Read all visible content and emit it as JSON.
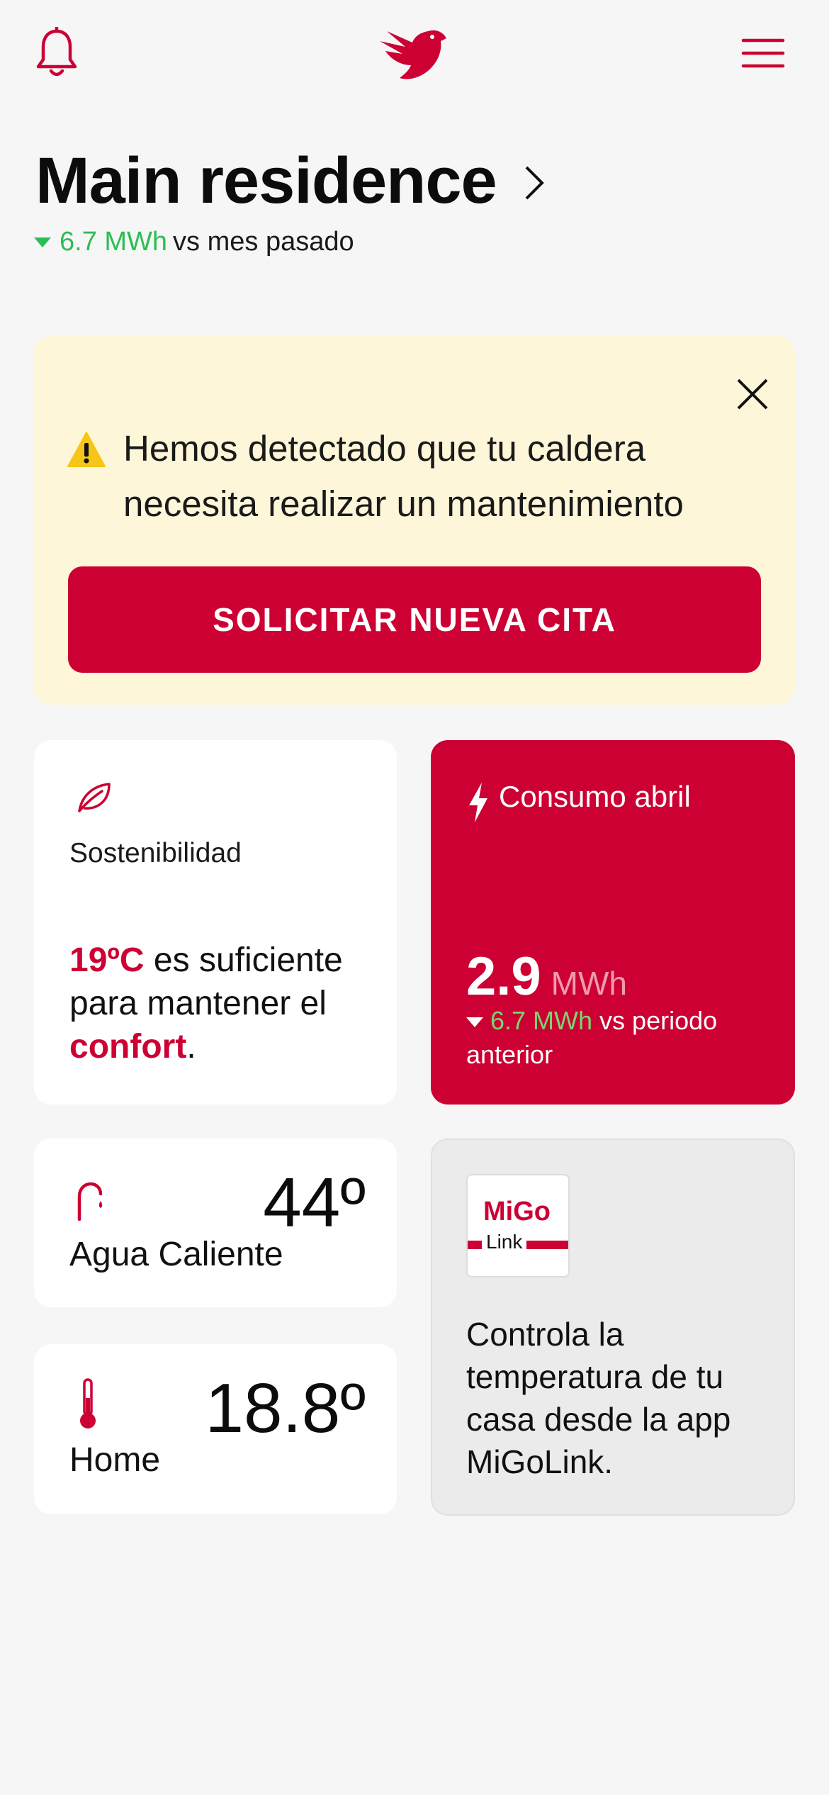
{
  "colors": {
    "brand": "#cc0033",
    "positive": "#2dbd55",
    "alert_bg": "#fef6d9",
    "background": "#f6f6f6"
  },
  "header": {
    "left_icon": "bell-icon",
    "center_icon": "bird-logo",
    "right_icon": "hamburger-menu-icon"
  },
  "residence": {
    "title": "Main residence",
    "delta_value": "6.7 MWh",
    "delta_label": "vs mes pasado",
    "delta_direction": "down"
  },
  "alert": {
    "message": "Hemos detectado que tu caldera necesita realizar un mantenimiento",
    "button_label": "SOLICITAR NUEVA CITA",
    "icon": "warning-icon",
    "close_icon": "close-icon"
  },
  "sustainability": {
    "label": "Sostenibilidad",
    "temp": "19ºC",
    "text_mid": " es suficiente para mantener el ",
    "highlight": "confort",
    "text_end": "."
  },
  "consumption": {
    "label": "Consumo abril",
    "value": "2.9",
    "unit": "MWh",
    "delta_value": "6.7 MWh",
    "delta_label": " vs periodo anterior",
    "delta_direction": "down"
  },
  "hot_water": {
    "label": "Agua Caliente",
    "temperature": "44º",
    "icon": "faucet-icon"
  },
  "home_temp": {
    "label": "Home",
    "temperature": "18.8º",
    "icon": "thermometer-icon"
  },
  "promo": {
    "logo_top": "MiGo",
    "logo_bottom": "Link",
    "text": "Controla la temperatura de tu casa desde la app MiGoLink."
  }
}
